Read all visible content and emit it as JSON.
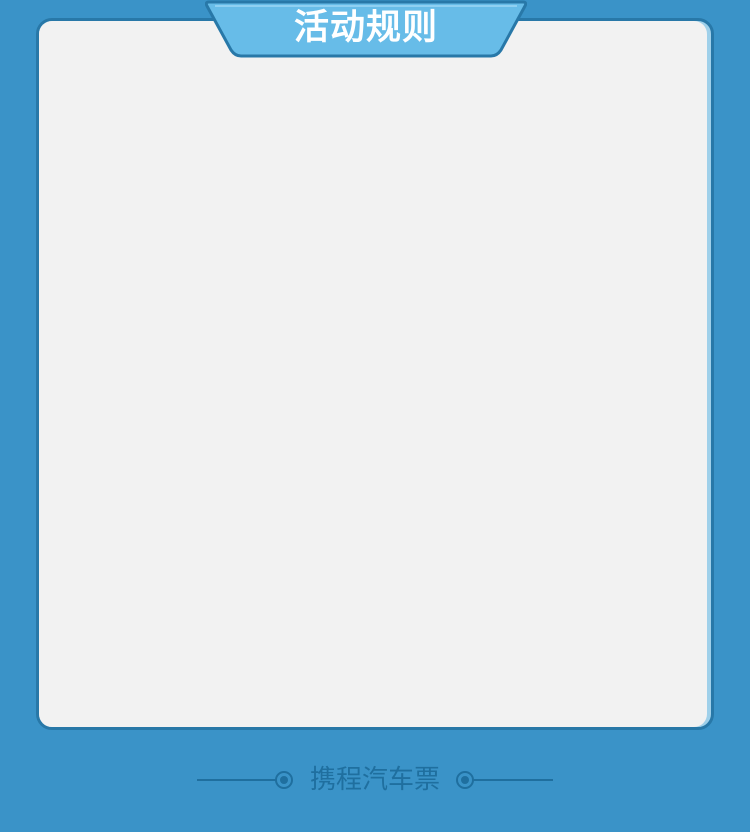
{
  "header": {
    "title": "活动规则"
  },
  "footer": {
    "brand": "携程汽车票"
  },
  "colors": {
    "background": "#3a93c8",
    "panel": "#f2f2f2",
    "panel_border": "#2878a8",
    "tab_fill": "#67bce8",
    "footer_text": "#1f6f9f"
  }
}
